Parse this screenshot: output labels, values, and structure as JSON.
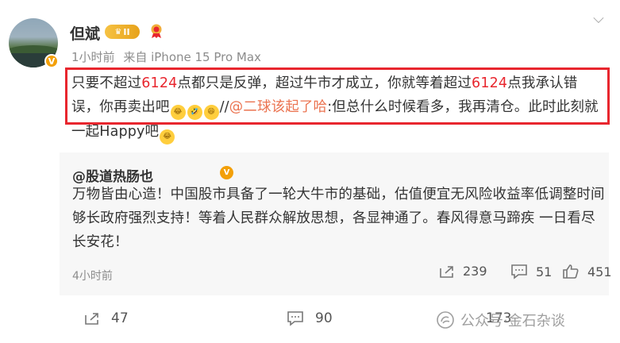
{
  "post": {
    "username": "但斌",
    "level_badge": "II",
    "time": "1小时前",
    "source": "来自 iPhone 15 Pro Max",
    "text_parts": {
      "p1": "只要不超过",
      "p2": "6124",
      "p3": "点都只是反弹，超过牛市才成立，你就等着超过",
      "p4": "6124",
      "p5": "点我承认错误，你再卖出吧",
      "p6": "//",
      "mention": "@二球该起了哈",
      "p7": ":但总什么时候看多，我再清仓。此时此刻就一起Happy吧"
    },
    "emojis": [
      "laugh-cry-emoji",
      "rolling-laugh-emoji",
      "grin-emoji",
      "laugh-cry-emoji"
    ]
  },
  "repost": {
    "author": "@股道热肠也",
    "text": "万物皆由心造！中国股市具备了一轮大牛市的基础，估值便宜无风险收益率低调整时间够长政府强烈支持！等着人民群众解放思想，各显神通了。春风得意马蹄疾 一日看尽长安花！",
    "time": "4小时前",
    "reposts": "239",
    "comments": "51",
    "likes": "451"
  },
  "footer": {
    "reposts": "47",
    "comments": "90",
    "likes": "173"
  },
  "watermark": "公众号·金石杂谈",
  "colors": {
    "highlight_box": "#e8262e",
    "mention": "#eb7350",
    "badge": "#f3a008"
  }
}
